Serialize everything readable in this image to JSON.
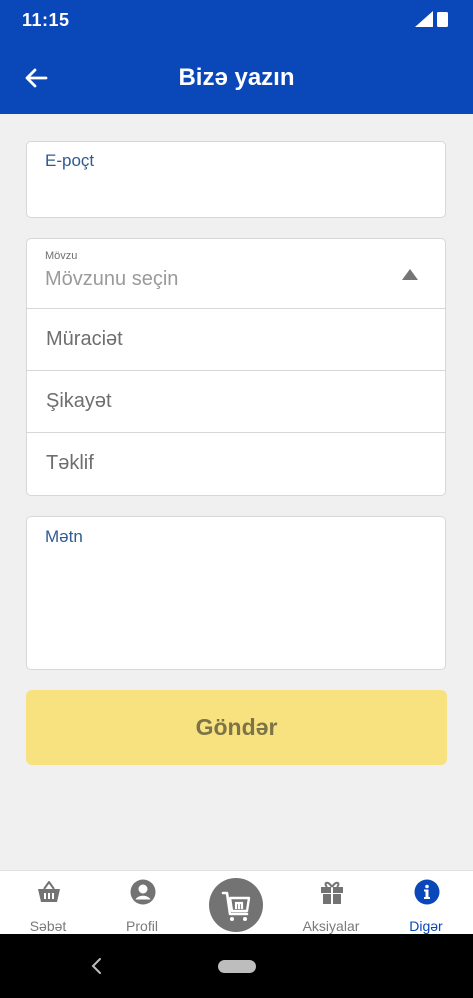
{
  "status_bar": {
    "time": "11:15"
  },
  "app_bar": {
    "title": "Bizə yazın"
  },
  "form": {
    "email_label": "E-poçt",
    "subject": {
      "small_label": "Mövzu",
      "placeholder": "Mövzunu seçin",
      "options": [
        "Müraciət",
        "Şikayət",
        "Təklif"
      ]
    },
    "text_label": "Mətn",
    "submit_label": "Göndər"
  },
  "bottom_nav": {
    "items": [
      {
        "label": "Səbət",
        "icon": "basket-icon"
      },
      {
        "label": "Profil",
        "icon": "profile-icon"
      },
      {
        "label": "",
        "icon": "brand-logo-icon"
      },
      {
        "label": "Aksiyalar",
        "icon": "gift-icon"
      },
      {
        "label": "Digər",
        "icon": "info-icon"
      }
    ],
    "active": "Digər"
  },
  "colors": {
    "primary": "#0a47b8",
    "button": "#f8e27f",
    "button_text": "#7c7448",
    "background": "#f0f0f0"
  }
}
